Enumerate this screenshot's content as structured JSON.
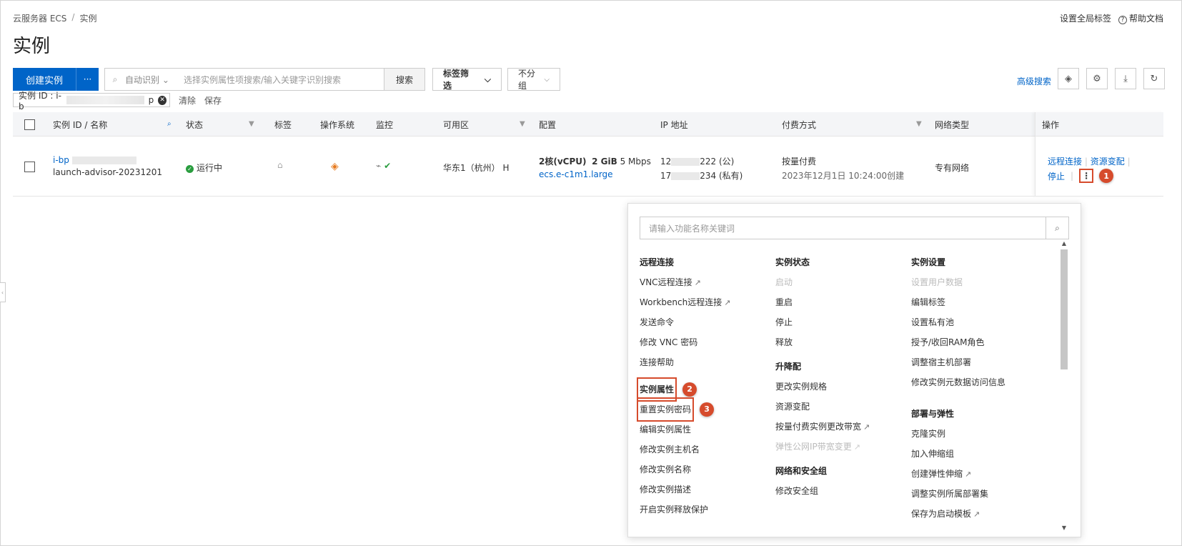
{
  "breadcrumb": {
    "service": "云服务器 ECS",
    "separator": "/",
    "current": "实例"
  },
  "header_links": {
    "global_tags": "设置全局标签",
    "help_docs": "帮助文档"
  },
  "page_title": "实例",
  "toolbar": {
    "create_label": "创建实例",
    "more_label": "···",
    "search_mode": "自动识别",
    "search_placeholder": "选择实例属性项搜索/输入关键字识别搜索",
    "search_button": "搜索",
    "tag_filter": "标签筛选",
    "group_select": "不分组",
    "advanced_search": "高级搜索"
  },
  "filter_chip": {
    "label": "实例 ID : i-b",
    "suffix": "p",
    "clear": "清除",
    "save": "保存"
  },
  "table": {
    "headers": [
      "实例 ID / 名称",
      "状态",
      "标签",
      "操作系统",
      "监控",
      "可用区",
      "配置",
      "IP 地址",
      "付费方式",
      "网络类型",
      "操作"
    ],
    "row": {
      "instance_id": "i-bp",
      "instance_name": "launch-advisor-20231201",
      "status": "运行中",
      "zone": "华东1（杭州） H",
      "config_cpu": "2核(vCPU)",
      "config_mem": "2 GiB",
      "config_bw": "5 Mbps",
      "config_type": "ecs.e-c1m1.large",
      "ip_public_prefix": "12",
      "ip_public_suffix": "222 (公)",
      "ip_private_prefix": "17",
      "ip_private_suffix": "234 (私有)",
      "billing": "按量付费",
      "created": "2023年12月1日 10:24:00创建",
      "network": "专有网络",
      "actions": {
        "remote": "远程连接",
        "resize": "资源变配",
        "stop": "停止"
      }
    }
  },
  "markers": {
    "one": "1",
    "two": "2",
    "three": "3"
  },
  "dropdown": {
    "search_placeholder": "请输入功能名称关键词",
    "col1": {
      "remote_title": "远程连接",
      "vnc": "VNC远程连接",
      "workbench": "Workbench远程连接",
      "send_command": "发送命令",
      "modify_vnc": "修改 VNC 密码",
      "connect_help": "连接帮助",
      "instance_attr": "实例属性",
      "reset_pwd": "重置实例密码",
      "edit_attr": "编辑实例属性",
      "edit_hostname": "修改实例主机名",
      "edit_name": "修改实例名称",
      "edit_desc": "修改实例描述",
      "release_protect": "开启实例释放保护"
    },
    "col2": {
      "state_title": "实例状态",
      "start": "启动",
      "restart": "重启",
      "stop": "停止",
      "release": "释放",
      "upgrade_title": "升降配",
      "change_spec": "更改实例规格",
      "resize": "资源变配",
      "payg_bandwidth": "按量付费实例更改带宽",
      "eip_bandwidth": "弹性公网IP带宽变更",
      "net_title": "网络和安全组",
      "sec_group": "修改安全组"
    },
    "col3": {
      "settings_title": "实例设置",
      "user_data": "设置用户数据",
      "edit_tags": "编辑标签",
      "private_pool": "设置私有池",
      "ram_role": "授予/收回RAM角色",
      "host_deploy": "调整宿主机部署",
      "metadata": "修改实例元数据访问信息",
      "deploy_title": "部署与弹性",
      "clone": "克隆实例",
      "add_scaling": "加入伸缩组",
      "create_scaling": "创建弹性伸缩",
      "deploy_set": "调整实例所属部署集",
      "save_template": "保存为启动模板"
    }
  }
}
